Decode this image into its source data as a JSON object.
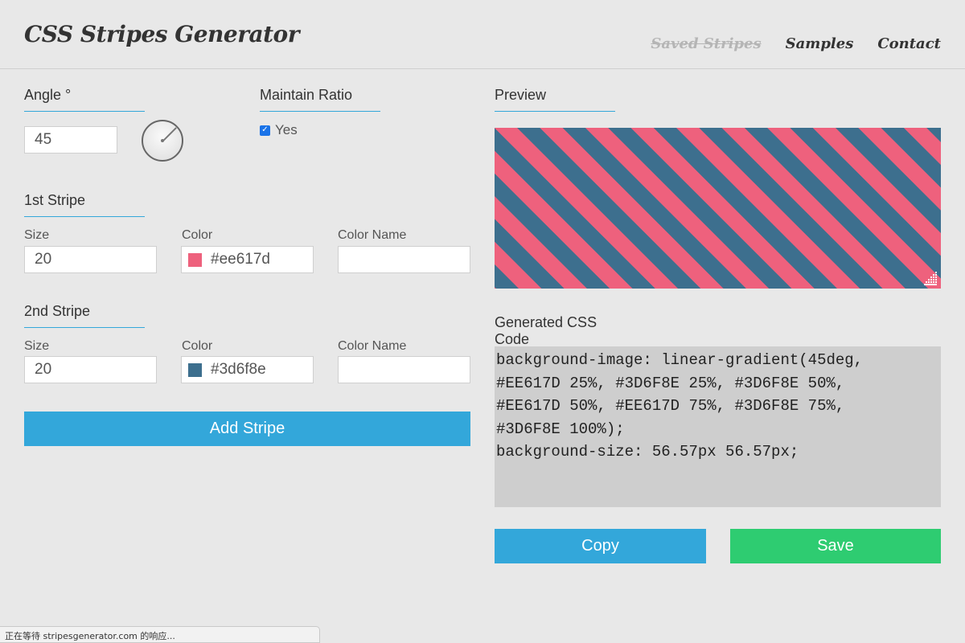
{
  "app": {
    "logo": "CSS Stripes Generator"
  },
  "nav": {
    "saved": "Saved Stripes",
    "samples": "Samples",
    "contact": "Contact"
  },
  "angle": {
    "title": "Angle °",
    "value": "45"
  },
  "ratio": {
    "title": "Maintain Ratio",
    "checkbox_label": "Yes",
    "checked": true
  },
  "stripe1": {
    "title": "1st Stripe",
    "size_label": "Size",
    "size_value": "20",
    "color_label": "Color",
    "color_value": "#ee617d",
    "color_hex": "#ee617d",
    "name_label": "Color Name",
    "name_value": ""
  },
  "stripe2": {
    "title": "2nd Stripe",
    "size_label": "Size",
    "size_value": "20",
    "color_label": "Color",
    "color_value": "#3d6f8e",
    "color_hex": "#3d6f8e",
    "name_label": "Color Name",
    "name_value": ""
  },
  "buttons": {
    "add_stripe": "Add Stripe",
    "copy": "Copy",
    "save": "Save"
  },
  "preview": {
    "title": "Preview"
  },
  "code": {
    "title": "Generated CSS Code",
    "lines": [
      "background-image: linear-gradient(45deg,",
      "#EE617D 25%, #3D6F8E 25%, #3D6F8E 50%,",
      "#EE617D 50%, #EE617D 75%, #3D6F8E 75%,",
      "#3D6F8E 100%);",
      "background-size: 56.57px 56.57px;"
    ]
  },
  "status": {
    "text": "正在等待 stripesgenerator.com 的响应..."
  },
  "colors": {
    "accent": "#33a7da",
    "save_green": "#2ecc71",
    "stripe_pink": "#ee617d",
    "stripe_blue": "#3d6f8e"
  },
  "icons": {
    "resize": "resize-grip-icon",
    "dial": "angle-dial-icon",
    "check": "checkmark-icon"
  }
}
